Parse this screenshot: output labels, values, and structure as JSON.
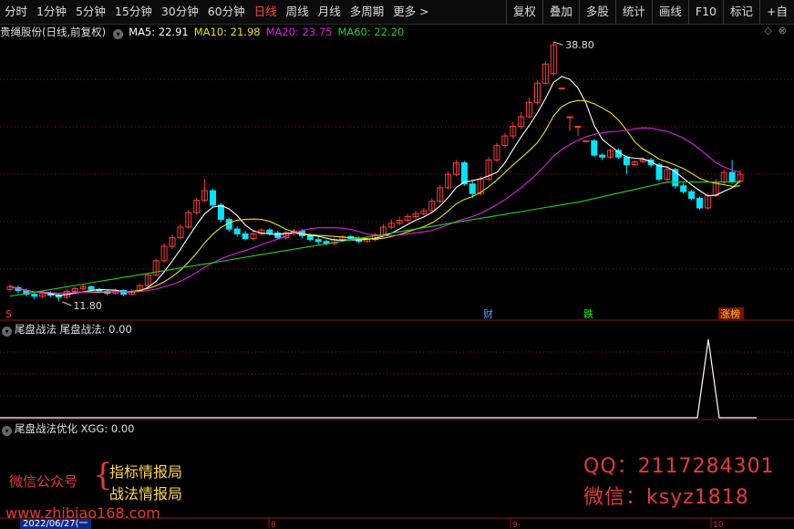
{
  "toolbar": {
    "periods": [
      "分时",
      "1分钟",
      "5分钟",
      "15分钟",
      "30分钟",
      "60分钟",
      "日线",
      "周线",
      "月线",
      "多周期",
      "更多 >"
    ],
    "active_period": "日线",
    "right_buttons": [
      "复权",
      "叠加",
      "多股",
      "统计",
      "画线",
      "F10",
      "标记",
      "+自"
    ]
  },
  "main": {
    "stock": "贵绳股份(日线,前复权)",
    "ma5": "MA5: 22.91",
    "ma10": "MA10: 21.98",
    "ma20": "MA20: 23.75",
    "ma60": "MA60: 22.20",
    "high_label": "38.80",
    "low_label": "11.80",
    "markers": [
      "S",
      "财",
      "跌",
      "涨榜"
    ]
  },
  "colors": {
    "up": "#ff3b3b",
    "down": "#00e5ff",
    "ma5": "#ffffff",
    "ma10": "#e6e600",
    "ma20": "#e020e0",
    "ma60": "#22d122",
    "bg": "#000000",
    "grid": "#8b1a1a"
  },
  "indicator1": {
    "title": "尾盘战法",
    "value_label": "尾盘战法: 0.00"
  },
  "indicator2": {
    "title": "尾盘战法优化",
    "value_label": "XGG: 0.00"
  },
  "watermark": {
    "wechat_label": "微信公众号",
    "brace": "{",
    "line1": "指标情报局",
    "line2": "战法情报局",
    "qq": "QQ：2117284301",
    "wechat": "微信：ksyz1818",
    "url": "www.zhibiao168.com"
  },
  "axis": {
    "date": "2022/06/27(一",
    "month_ticks": [
      "8",
      "9",
      "10"
    ]
  }
}
